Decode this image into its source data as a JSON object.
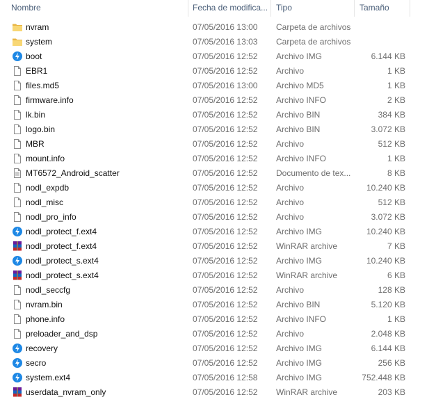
{
  "columns": {
    "name": "Nombre",
    "date": "Fecha de modifica...",
    "type": "Tipo",
    "size": "Tamaño"
  },
  "files": [
    {
      "name": "nvram",
      "date": "07/05/2016 13:00",
      "type": "Carpeta de archivos",
      "size": "",
      "icon": "folder-icon"
    },
    {
      "name": "system",
      "date": "07/05/2016 13:03",
      "type": "Carpeta de archivos",
      "size": "",
      "icon": "folder-icon"
    },
    {
      "name": "boot",
      "date": "07/05/2016 12:52",
      "type": "Archivo IMG",
      "size": "6.144 KB",
      "icon": "img-file-icon"
    },
    {
      "name": "EBR1",
      "date": "07/05/2016 12:52",
      "type": "Archivo",
      "size": "1 KB",
      "icon": "file-icon"
    },
    {
      "name": "files.md5",
      "date": "07/05/2016 13:00",
      "type": "Archivo MD5",
      "size": "1 KB",
      "icon": "file-icon"
    },
    {
      "name": "firmware.info",
      "date": "07/05/2016 12:52",
      "type": "Archivo INFO",
      "size": "2 KB",
      "icon": "file-icon"
    },
    {
      "name": "lk.bin",
      "date": "07/05/2016 12:52",
      "type": "Archivo BIN",
      "size": "384 KB",
      "icon": "file-icon"
    },
    {
      "name": "logo.bin",
      "date": "07/05/2016 12:52",
      "type": "Archivo BIN",
      "size": "3.072 KB",
      "icon": "file-icon"
    },
    {
      "name": "MBR",
      "date": "07/05/2016 12:52",
      "type": "Archivo",
      "size": "512 KB",
      "icon": "file-icon"
    },
    {
      "name": "mount.info",
      "date": "07/05/2016 12:52",
      "type": "Archivo INFO",
      "size": "1 KB",
      "icon": "file-icon"
    },
    {
      "name": "MT6572_Android_scatter",
      "date": "07/05/2016 12:52",
      "type": "Documento de tex...",
      "size": "8 KB",
      "icon": "text-file-icon"
    },
    {
      "name": "nodl_expdb",
      "date": "07/05/2016 12:52",
      "type": "Archivo",
      "size": "10.240 KB",
      "icon": "file-icon"
    },
    {
      "name": "nodl_misc",
      "date": "07/05/2016 12:52",
      "type": "Archivo",
      "size": "512 KB",
      "icon": "file-icon"
    },
    {
      "name": "nodl_pro_info",
      "date": "07/05/2016 12:52",
      "type": "Archivo",
      "size": "3.072 KB",
      "icon": "file-icon"
    },
    {
      "name": "nodl_protect_f.ext4",
      "date": "07/05/2016 12:52",
      "type": "Archivo IMG",
      "size": "10.240 KB",
      "icon": "img-file-icon"
    },
    {
      "name": "nodl_protect_f.ext4",
      "date": "07/05/2016 12:52",
      "type": "WinRAR archive",
      "size": "7 KB",
      "icon": "winrar-icon"
    },
    {
      "name": "nodl_protect_s.ext4",
      "date": "07/05/2016 12:52",
      "type": "Archivo IMG",
      "size": "10.240 KB",
      "icon": "img-file-icon"
    },
    {
      "name": "nodl_protect_s.ext4",
      "date": "07/05/2016 12:52",
      "type": "WinRAR archive",
      "size": "6 KB",
      "icon": "winrar-icon"
    },
    {
      "name": "nodl_seccfg",
      "date": "07/05/2016 12:52",
      "type": "Archivo",
      "size": "128 KB",
      "icon": "file-icon"
    },
    {
      "name": "nvram.bin",
      "date": "07/05/2016 12:52",
      "type": "Archivo BIN",
      "size": "5.120 KB",
      "icon": "file-icon"
    },
    {
      "name": "phone.info",
      "date": "07/05/2016 12:52",
      "type": "Archivo INFO",
      "size": "1 KB",
      "icon": "file-icon"
    },
    {
      "name": "preloader_and_dsp",
      "date": "07/05/2016 12:52",
      "type": "Archivo",
      "size": "2.048 KB",
      "icon": "file-icon"
    },
    {
      "name": "recovery",
      "date": "07/05/2016 12:52",
      "type": "Archivo IMG",
      "size": "6.144 KB",
      "icon": "img-file-icon"
    },
    {
      "name": "secro",
      "date": "07/05/2016 12:52",
      "type": "Archivo IMG",
      "size": "256 KB",
      "icon": "img-file-icon"
    },
    {
      "name": "system.ext4",
      "date": "07/05/2016 12:58",
      "type": "Archivo IMG",
      "size": "752.448 KB",
      "icon": "img-file-icon"
    },
    {
      "name": "userdata_nvram_only",
      "date": "07/05/2016 12:52",
      "type": "WinRAR archive",
      "size": "203 KB",
      "icon": "winrar-icon"
    }
  ]
}
